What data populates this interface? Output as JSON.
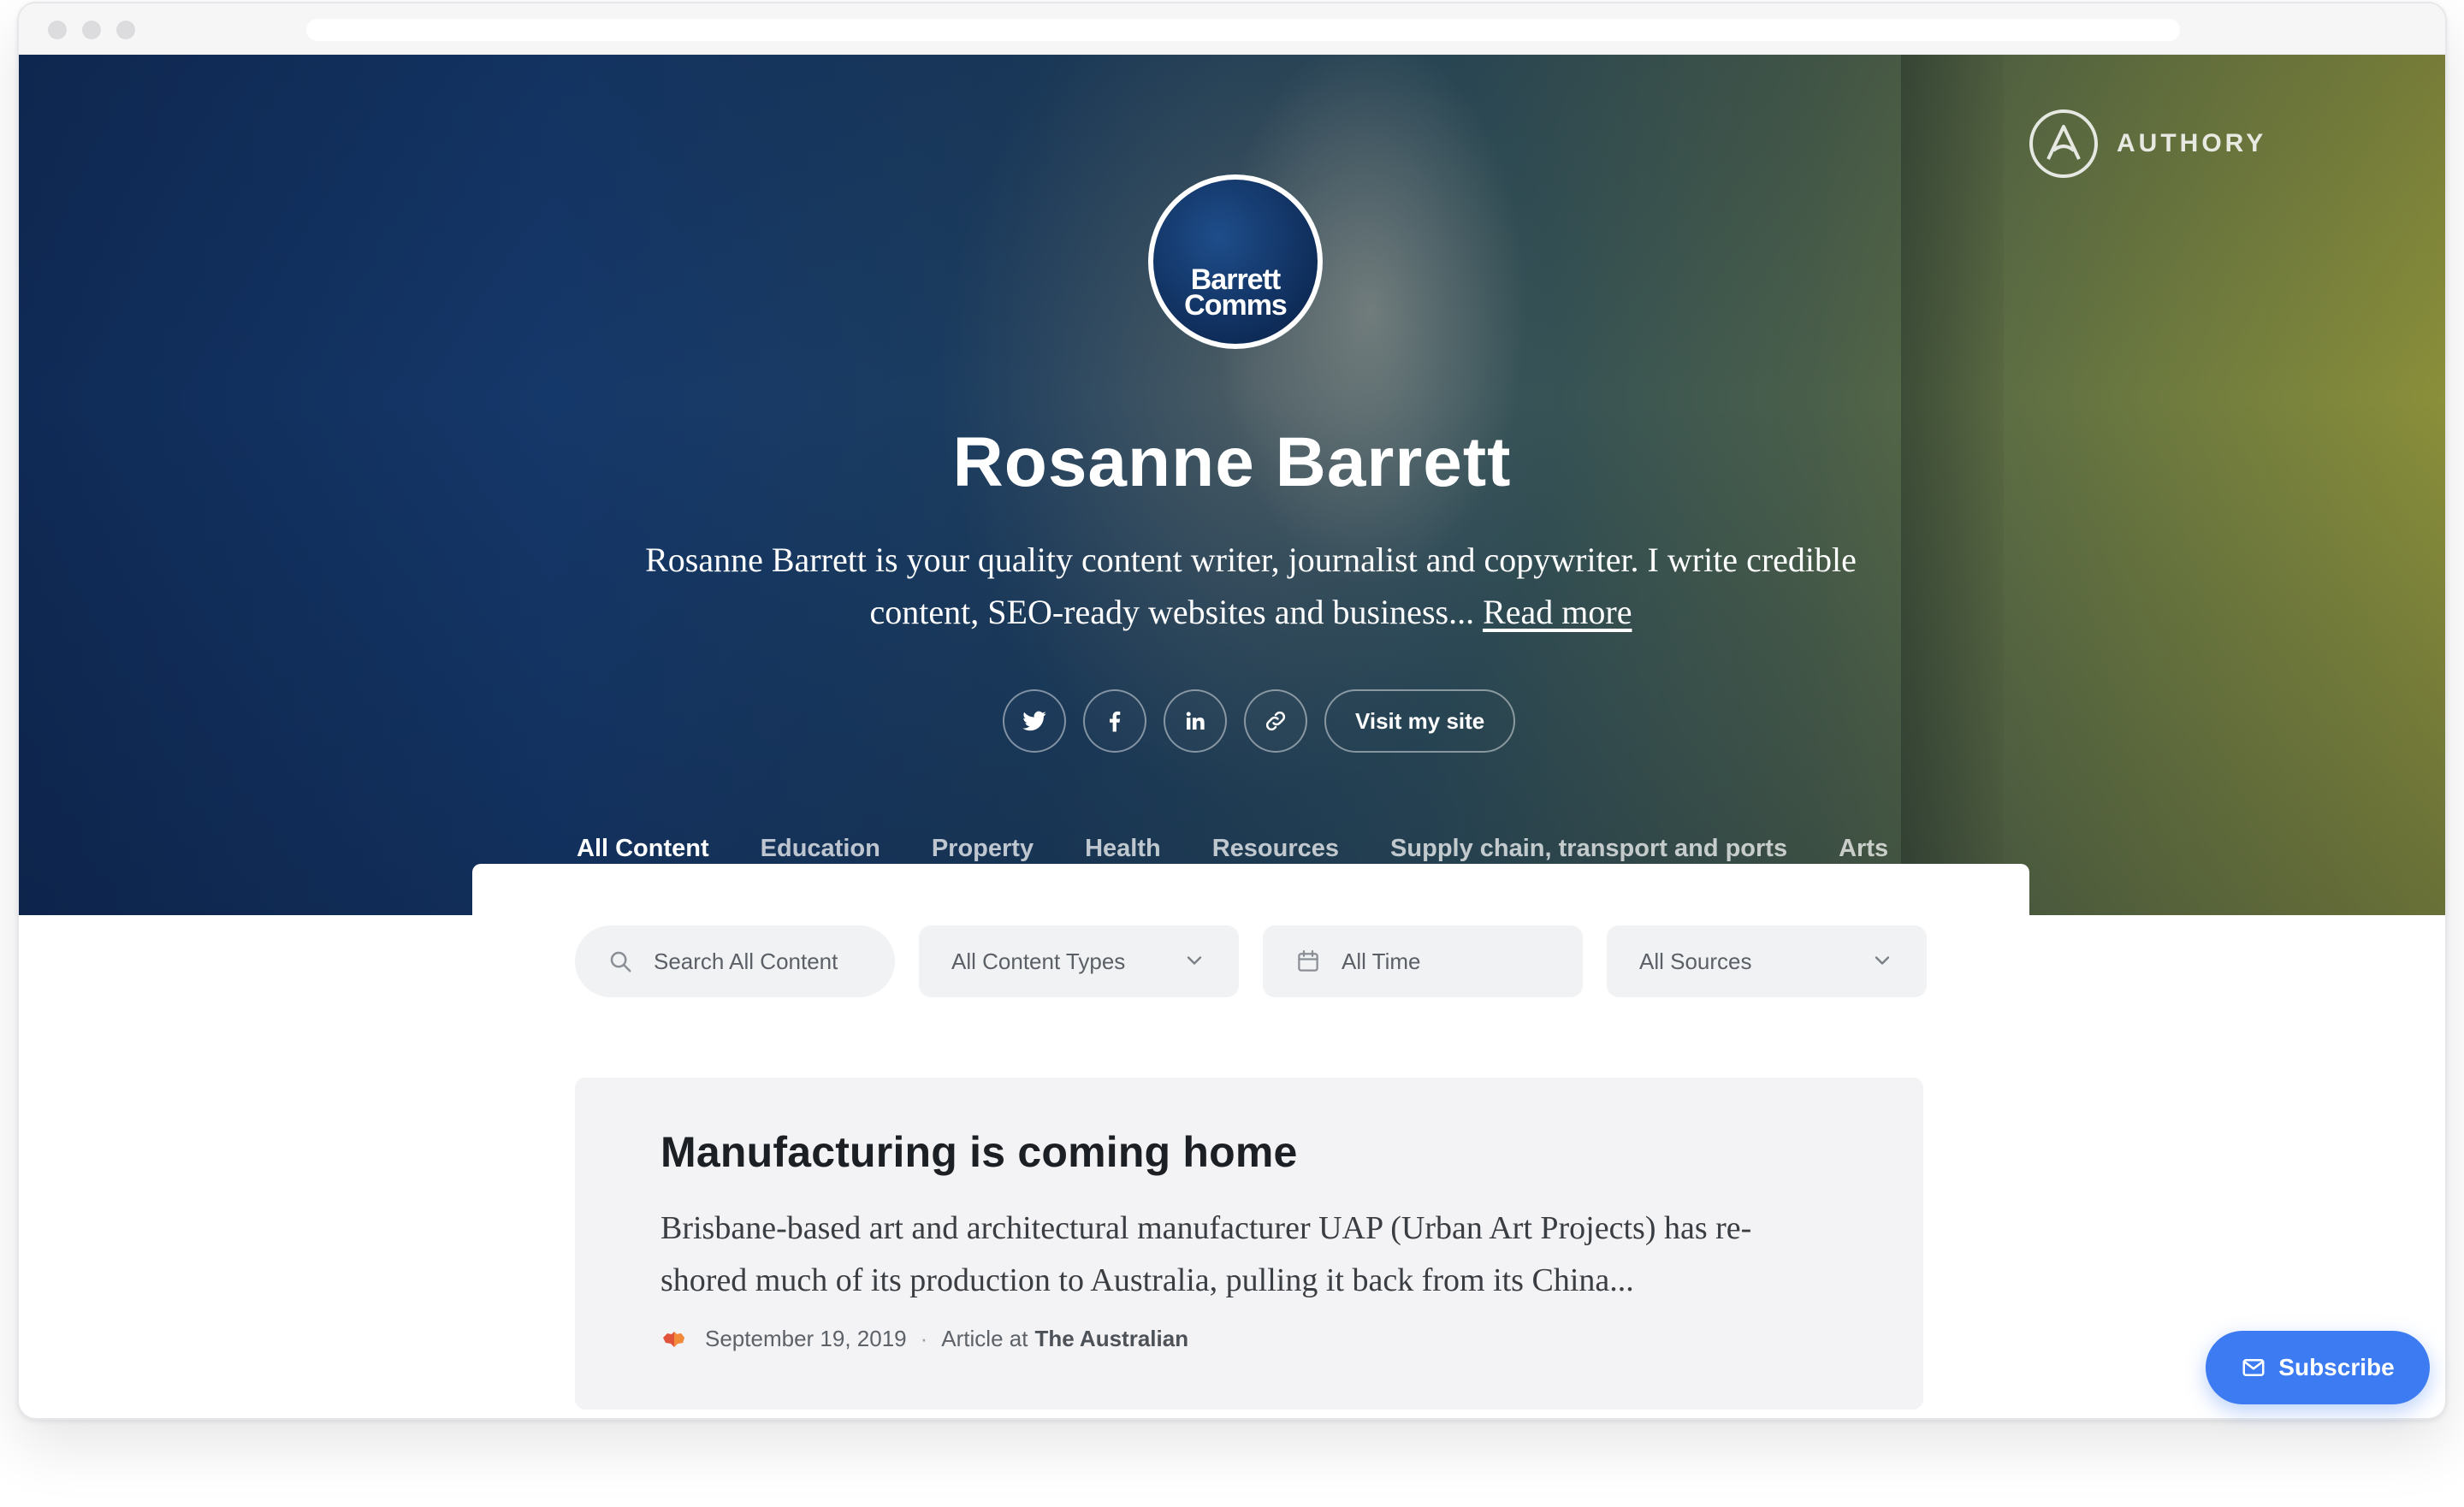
{
  "brand": {
    "name": "AUTHORY"
  },
  "profile": {
    "avatar_line1": "Barrett",
    "avatar_line2": "Comms",
    "name": "Rosanne Barrett",
    "bio": "Rosanne Barrett is your quality content writer, journalist and copywriter. I write credible content, SEO-ready websites and business...",
    "read_more": "Read more"
  },
  "socials": {
    "items": [
      "twitter-icon",
      "facebook-icon",
      "linkedin-icon",
      "link-icon"
    ],
    "visit_label": "Visit my site"
  },
  "tabs": [
    {
      "label": "All Content",
      "active": true
    },
    {
      "label": "Education",
      "active": false
    },
    {
      "label": "Property",
      "active": false
    },
    {
      "label": "Health",
      "active": false
    },
    {
      "label": "Resources",
      "active": false
    },
    {
      "label": "Supply chain, transport and ports",
      "active": false
    },
    {
      "label": "Arts",
      "active": false
    }
  ],
  "filters": {
    "search_placeholder": "Search All Content",
    "content_types": "All Content Types",
    "time": "All Time",
    "sources": "All Sources"
  },
  "article": {
    "title": "Manufacturing is coming home",
    "excerpt": "Brisbane-based art and architectural manufacturer UAP (Urban Art Projects) has re-shored much of its production to Australia, pulling it back from its China...",
    "date": "September 19, 2019",
    "separator": "·",
    "type_prefix": "Article at",
    "source": "The Australian"
  },
  "subscribe": {
    "label": "Subscribe"
  },
  "colors": {
    "accent": "#3d7bf2",
    "card_bg": "#f3f3f5",
    "filter_bg": "#f1f2f4"
  }
}
